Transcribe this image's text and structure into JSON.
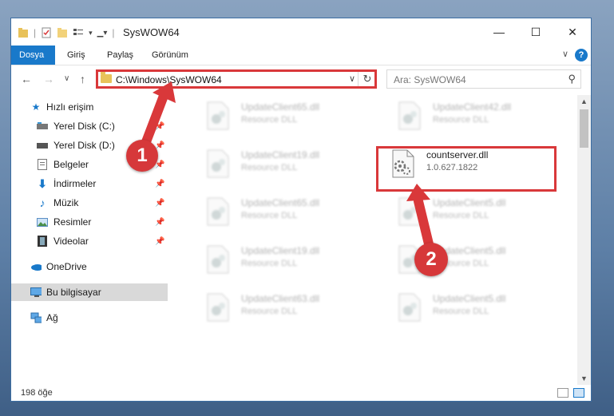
{
  "window": {
    "title": "SysWOW64",
    "minimize_label": "—",
    "maximize_label": "☐",
    "close_label": "✕"
  },
  "ribbon": {
    "tabs": [
      {
        "label": "Dosya"
      },
      {
        "label": "Giriş"
      },
      {
        "label": "Paylaş"
      },
      {
        "label": "Görünüm"
      }
    ],
    "help_label": "?"
  },
  "nav": {
    "back": "←",
    "forward": "→",
    "recent": "∨",
    "up": "↑"
  },
  "address": {
    "path": "C:\\Windows\\SysWOW64",
    "dropdown": "∨",
    "refresh": "↻"
  },
  "search": {
    "placeholder": "Ara: SysWOW64",
    "icon": "search-icon"
  },
  "sidebar": {
    "items": [
      {
        "label": "Hızlı erişim",
        "icon": "star-icon"
      },
      {
        "label": "Yerel Disk (C:)",
        "icon": "drive-icon"
      },
      {
        "label": "Yerel Disk (D:)",
        "icon": "drive-icon"
      },
      {
        "label": "Belgeler",
        "icon": "document-icon"
      },
      {
        "label": "İndirmeler",
        "icon": "download-icon"
      },
      {
        "label": "Müzik",
        "icon": "music-icon"
      },
      {
        "label": "Resimler",
        "icon": "picture-icon"
      },
      {
        "label": "Videolar",
        "icon": "video-icon"
      },
      {
        "label": "OneDrive",
        "icon": "cloud-icon"
      },
      {
        "label": "Bu bilgisayar",
        "icon": "computer-icon"
      },
      {
        "label": "Ağ",
        "icon": "network-icon"
      }
    ]
  },
  "files": [
    {
      "name": "UpdateClient65.dll",
      "sub": "Resource DLL"
    },
    {
      "name": "UpdateClient42.dll",
      "sub": "Resource DLL"
    },
    {
      "name": "UpdateClient19.dll",
      "sub": "Resource DLL"
    },
    {
      "name": "countserver.dll",
      "sub": "1.0.627.1822"
    },
    {
      "name": "UpdateClient65.dll",
      "sub": "Resource DLL"
    },
    {
      "name": "UpdateClient5.dll",
      "sub": "Resource DLL"
    },
    {
      "name": "UpdateClient19.dll",
      "sub": "Resource DLL"
    },
    {
      "name": "UpdateClient5.dll",
      "sub": "Resource DLL"
    },
    {
      "name": "UpdateClient63.dll",
      "sub": "Resource DLL"
    },
    {
      "name": "UpdateClient5.dll",
      "sub": "Resource DLL"
    }
  ],
  "status": {
    "count": "198 öğe"
  },
  "callouts": {
    "one": "1",
    "two": "2"
  },
  "colors": {
    "accent": "#1979ca",
    "highlight_red": "#d9383a"
  }
}
